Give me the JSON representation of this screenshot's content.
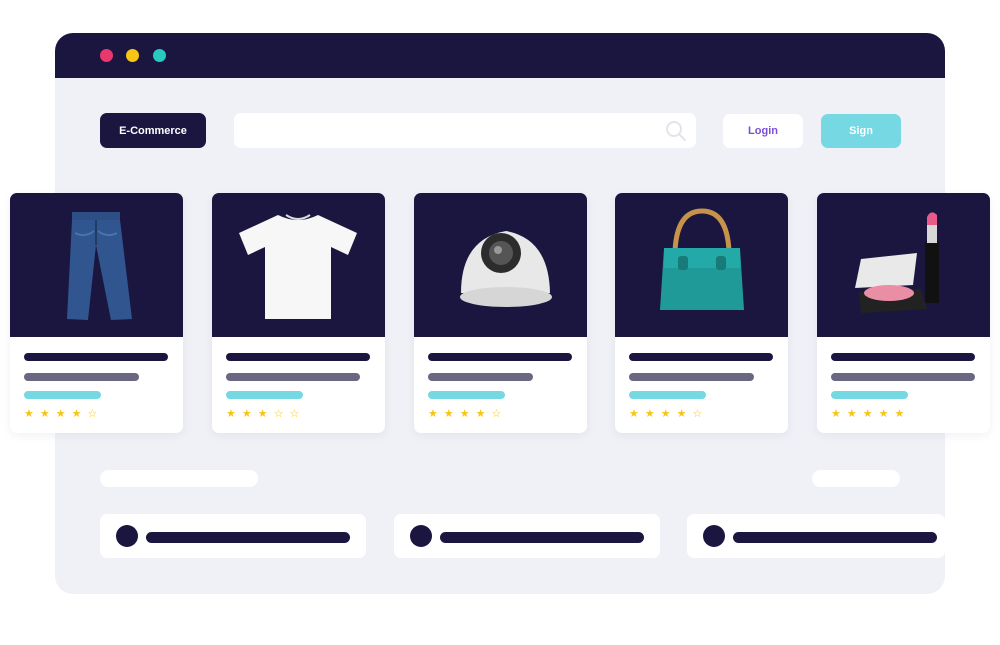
{
  "header": {
    "brand_label": "E-Commerce",
    "search": {
      "placeholder": ""
    },
    "login_label": "Login",
    "sign_label": "Sign"
  },
  "window_dots": [
    "red",
    "yellow",
    "teal"
  ],
  "colors": {
    "dark": "#1b1640",
    "accent": "#76d8e3",
    "star": "#f7c615",
    "background": "#f0f1f7"
  },
  "products": [
    {
      "name": "jeans",
      "icon": "jeans-icon",
      "rating": 4,
      "max": 5
    },
    {
      "name": "t-shirt",
      "icon": "tshirt-icon",
      "rating": 3,
      "max": 5
    },
    {
      "name": "security-camera",
      "icon": "camera-icon",
      "rating": 4,
      "max": 5
    },
    {
      "name": "handbag",
      "icon": "handbag-icon",
      "rating": 4,
      "max": 5
    },
    {
      "name": "makeup",
      "icon": "makeup-icon",
      "rating": 5,
      "max": 5
    }
  ]
}
